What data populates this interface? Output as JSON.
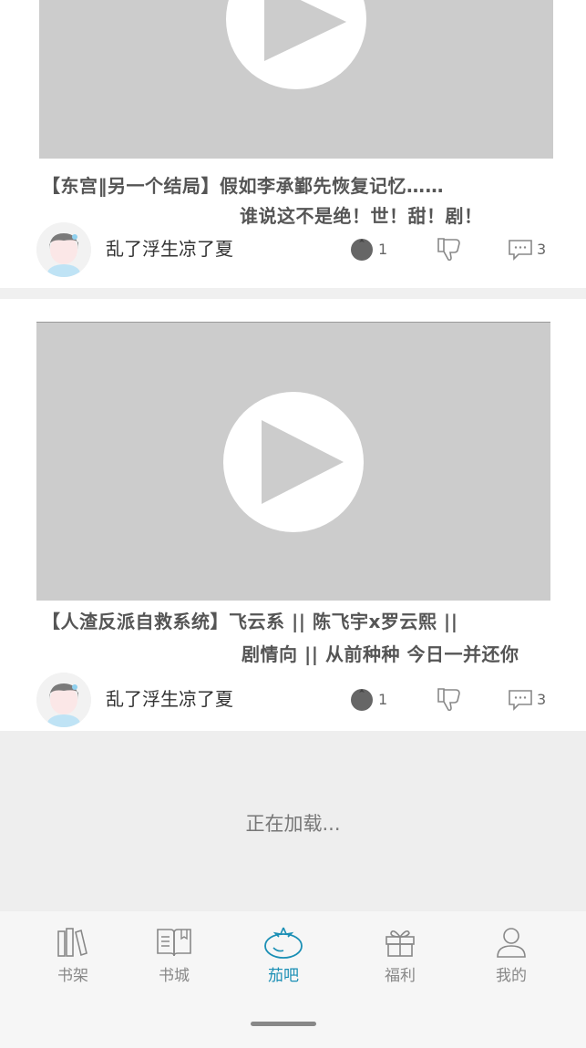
{
  "posts": [
    {
      "title_line1": "【东宫‖另一个结局】假如李承鄞先恢复记忆……",
      "title_line2": "谁说这不是绝！世！甜！剧！",
      "author": "乱了浮生凉了夏",
      "tomato_count": "1",
      "comment_count": "3"
    },
    {
      "title_line1": "【人渣反派自救系统】飞云系 || 陈飞宇x罗云熙 ||",
      "title_line2": "剧情向 || 从前种种 今日一并还你",
      "author": "乱了浮生凉了夏",
      "tomato_count": "1",
      "comment_count": "3"
    }
  ],
  "loading_text": "正在加载...",
  "tabbar": {
    "items": [
      {
        "label": "书架",
        "icon": "bookshelf-icon"
      },
      {
        "label": "书城",
        "icon": "open-book-icon"
      },
      {
        "label": "茄吧",
        "icon": "tomato-icon",
        "active": true
      },
      {
        "label": "福利",
        "icon": "gift-icon"
      },
      {
        "label": "我的",
        "icon": "person-icon"
      }
    ],
    "active_color": "#1a8fb5",
    "inactive_color": "#888888"
  }
}
